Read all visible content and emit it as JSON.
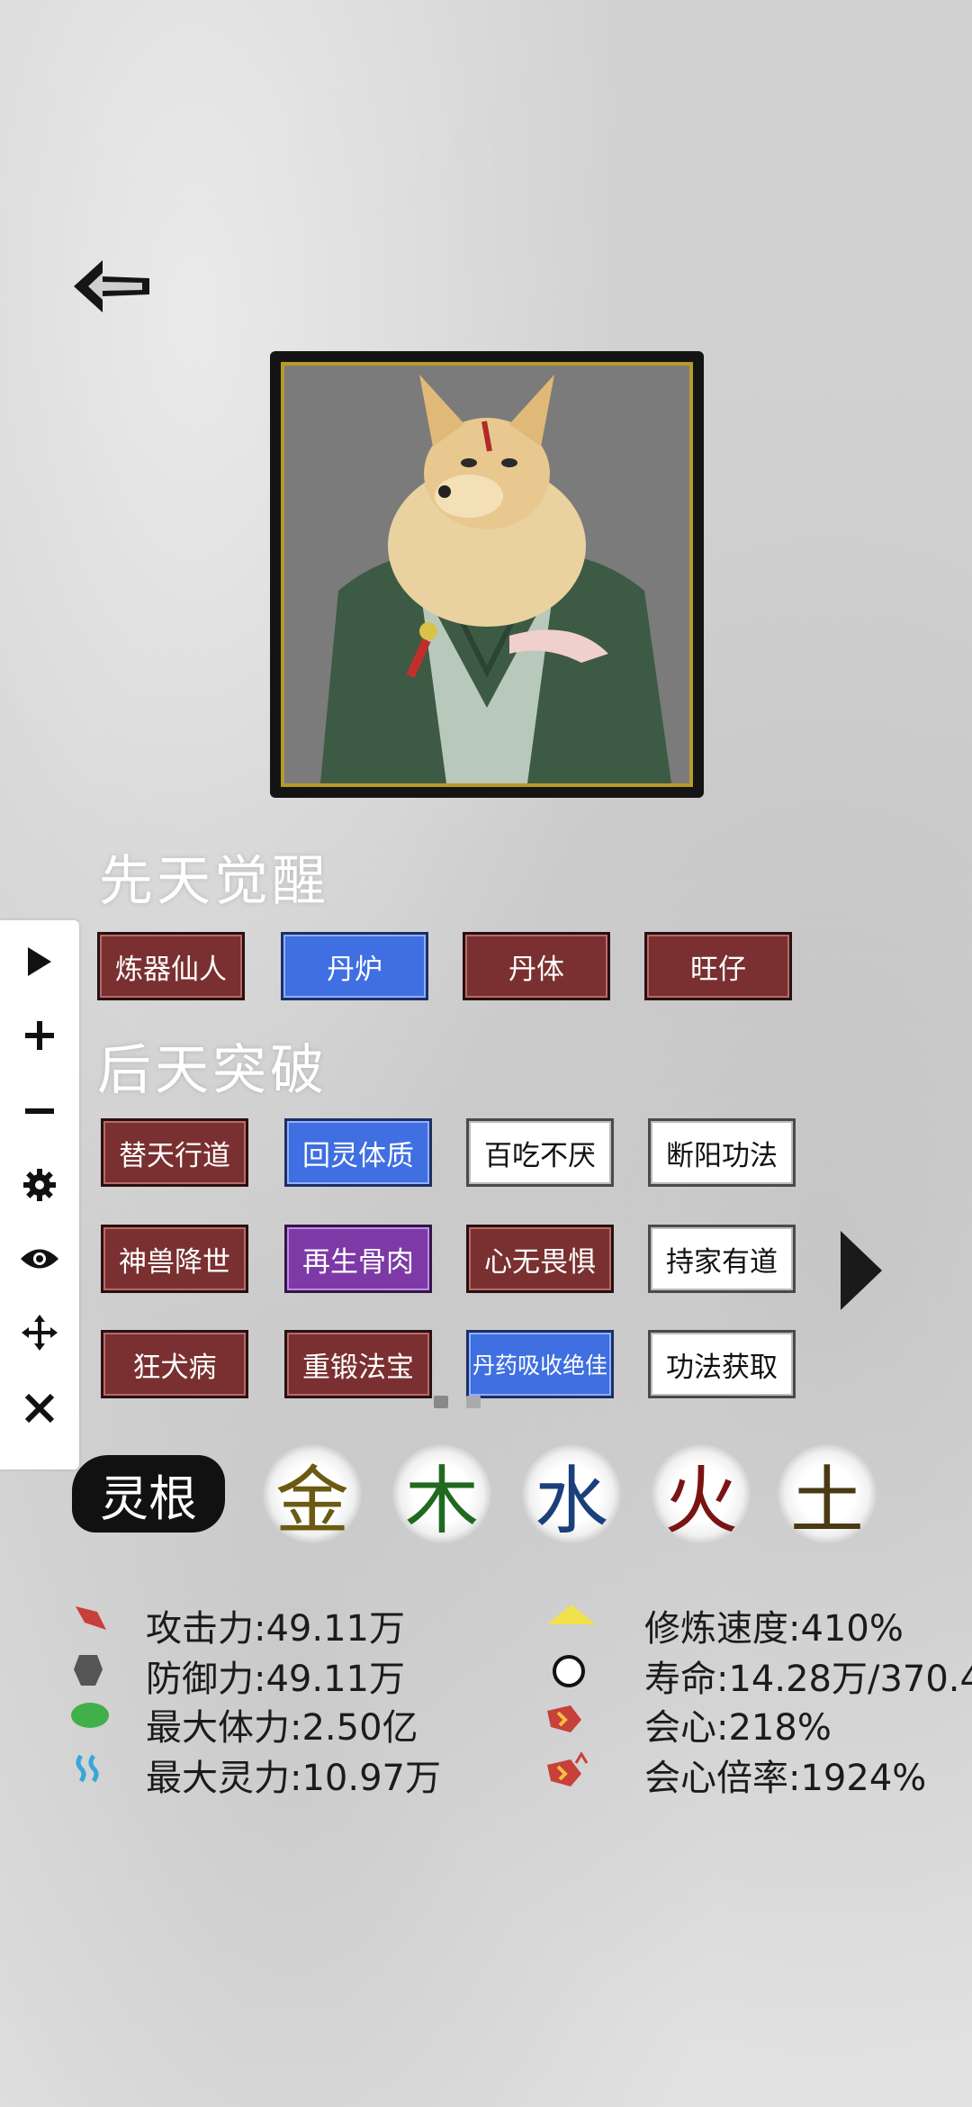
{
  "nav": {
    "back_icon": "back-arrow-icon"
  },
  "portrait": {
    "subject": "fox-cultivator-portrait"
  },
  "innate": {
    "title": "先天觉醒",
    "tags": [
      {
        "label": "炼器仙人",
        "style": "red"
      },
      {
        "label": "丹炉",
        "style": "blue"
      },
      {
        "label": "丹体",
        "style": "red"
      },
      {
        "label": "旺仔",
        "style": "red"
      }
    ]
  },
  "acquired": {
    "title": "后天突破",
    "tags": [
      {
        "label": "替天行道",
        "style": "red"
      },
      {
        "label": "回灵体质",
        "style": "blue"
      },
      {
        "label": "百吃不厌",
        "style": "white"
      },
      {
        "label": "断阳功法",
        "style": "white"
      },
      {
        "label": "神兽降世",
        "style": "red"
      },
      {
        "label": "再生骨肉",
        "style": "purple"
      },
      {
        "label": "心无畏惧",
        "style": "red"
      },
      {
        "label": "持家有道",
        "style": "white"
      },
      {
        "label": "狂犬病",
        "style": "red"
      },
      {
        "label": "重锻法宝",
        "style": "red"
      },
      {
        "label": "丹药吸收绝佳",
        "style": "blue"
      },
      {
        "label": "功法获取",
        "style": "white"
      }
    ]
  },
  "toolbar": [
    "play-icon",
    "plus-icon",
    "minus-icon",
    "gear-icon",
    "eye-icon",
    "move-icon",
    "close-icon"
  ],
  "spirit_root": {
    "label": "灵根",
    "elements": [
      {
        "char": "金",
        "color": "#6b5a12"
      },
      {
        "char": "木",
        "color": "#1f6a1f"
      },
      {
        "char": "水",
        "color": "#1a3f7a"
      },
      {
        "char": "火",
        "color": "#7a1414"
      },
      {
        "char": "土",
        "color": "#4a3a14"
      }
    ]
  },
  "stats_left": [
    {
      "text": "攻击力:49.11万",
      "icon": "attack-icon"
    },
    {
      "text": "防御力:49.11万",
      "icon": "defense-icon"
    },
    {
      "text": "最大体力:2.50亿",
      "icon": "hp-icon"
    },
    {
      "text": "最大灵力:10.97万",
      "icon": "spirit-power-icon"
    }
  ],
  "stats_right": [
    {
      "text": "修炼速度:410%",
      "icon": "cultivation-speed-icon"
    },
    {
      "text": "寿命:14.28万/370.4",
      "icon": "lifespan-icon"
    },
    {
      "text": "会心:218%",
      "icon": "crit-icon"
    },
    {
      "text": "会心倍率:1924%",
      "icon": "crit-multiplier-icon"
    }
  ]
}
